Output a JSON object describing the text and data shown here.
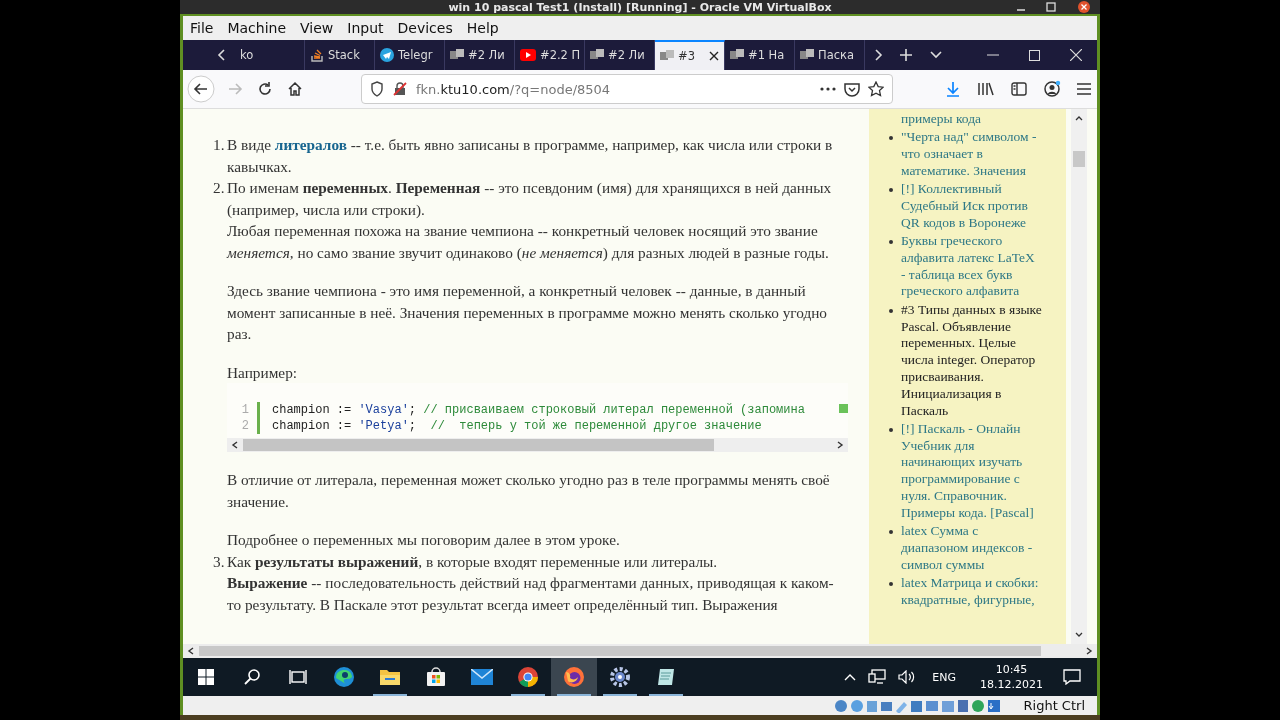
{
  "window": {
    "title": "win 10 pascal Test1 (Install) [Running] - Oracle VM VirtualBox"
  },
  "menu": [
    "File",
    "Machine",
    "View",
    "Input",
    "Devices",
    "Help"
  ],
  "tabs": [
    {
      "label": "ko",
      "kind": "none",
      "selected": false
    },
    {
      "label": "Stack",
      "kind": "stack",
      "selected": false
    },
    {
      "label": "Telegr",
      "kind": "telegram",
      "selected": false
    },
    {
      "label": "#2 Ли",
      "kind": "page",
      "selected": false
    },
    {
      "label": "#2.2 П",
      "kind": "video",
      "selected": false
    },
    {
      "label": "#2 Ли",
      "kind": "page",
      "selected": false
    },
    {
      "label": "#3",
      "kind": "page",
      "selected": true
    },
    {
      "label": "#1 На",
      "kind": "page",
      "selected": false
    },
    {
      "label": "Паска",
      "kind": "page",
      "selected": false
    }
  ],
  "address": {
    "prefix": "fkn.",
    "domain": "ktu10.com",
    "suffix": "/?q=node/8504"
  },
  "article": [
    {
      "marker": "1.",
      "blocks": [
        {
          "kind": "para",
          "spaced": false,
          "parts": [
            {
              "kind": "text",
              "text": "В виде "
            },
            {
              "kind": "link",
              "text": "литералов"
            },
            {
              "kind": "text",
              "text": " -- т.е. быть явно записаны в программе, например, как числа или строки в кавычках."
            }
          ]
        }
      ]
    },
    {
      "marker": "2.",
      "blocks": [
        {
          "kind": "para",
          "spaced": false,
          "parts": [
            {
              "kind": "text",
              "text": "По именам **переменных**. **Переменная** -- это псевдоним (имя) для хранящихся в ней данных (например, числа или строки)."
            }
          ]
        },
        {
          "kind": "para",
          "spaced": false,
          "parts": [
            {
              "kind": "text",
              "text": "Любая переменная похожа на звание чемпиона -- конкретный человек носящий это звание *меняется*, но само звание звучит одинаково (*не меняется*) для разных людей в разные годы."
            }
          ]
        },
        {
          "kind": "para",
          "spaced": true,
          "parts": [
            {
              "kind": "text",
              "text": "Здесь звание чемпиона - это имя переменной, а конкретный человек -- данные, в данный момент записанные в неё. Значения переменных в программе можно менять сколько угодно раз."
            }
          ]
        },
        {
          "kind": "para",
          "spaced": true,
          "parts": [
            {
              "kind": "text",
              "text": "Например:"
            }
          ]
        },
        {
          "kind": "code",
          "spaced": true,
          "lines": [
            {
              "number": "1",
              "tokens": [
                {
                  "kind": "ident",
                  "text": "champion"
                },
                {
                  "kind": "op",
                  "text": " := "
                },
                {
                  "kind": "string",
                  "text": "'Vasya'"
                },
                {
                  "kind": "op",
                  "text": "; "
                },
                {
                  "kind": "comment",
                  "text": "// присваиваем строковый литерал переменной (запомина"
                }
              ]
            },
            {
              "number": "2",
              "tokens": [
                {
                  "kind": "ident",
                  "text": "champion"
                },
                {
                  "kind": "op",
                  "text": " := "
                },
                {
                  "kind": "string",
                  "text": "'Petya'"
                },
                {
                  "kind": "op",
                  "text": ";  "
                },
                {
                  "kind": "comment",
                  "text": "//  теперь у той же переменной другое значение"
                }
              ]
            }
          ]
        },
        {
          "kind": "para",
          "spaced": true,
          "parts": [
            {
              "kind": "text",
              "text": "В отличие от литерала, переменная может сколько угодно раз в теле программы менять своё значение."
            }
          ]
        },
        {
          "kind": "para",
          "spaced": true,
          "parts": [
            {
              "kind": "text",
              "text": "Подробнее о переменных мы поговорим далее в этом уроке."
            }
          ]
        }
      ]
    },
    {
      "marker": "3.",
      "blocks": [
        {
          "kind": "para",
          "spaced": false,
          "parts": [
            {
              "kind": "text",
              "text": "Как **результаты выражений**, в которые входят переменные или литералы."
            }
          ]
        },
        {
          "kind": "para",
          "spaced": false,
          "parts": [
            {
              "kind": "text",
              "text": "**Выражение** -- последовательность действий над фрагментами данных, приводящая к каком-то результату. В Паскале этот результат всегда имеет определённый тип. Выражения"
            }
          ]
        }
      ]
    }
  ],
  "sidebar": [
    {
      "kind": "continuation",
      "text": "примеры кода",
      "selected": false
    },
    {
      "kind": "item",
      "text": "\"Черта над\" символом - что означает в математике. Значения",
      "selected": false
    },
    {
      "kind": "item",
      "text": "[!] Коллективный Судебный Иск против QR кодов в Воронеже",
      "selected": false
    },
    {
      "kind": "item",
      "text": "Буквы греческого алфавита латекс LaTeX - таблица всех букв греческого алфавита",
      "selected": false
    },
    {
      "kind": "item",
      "text": "#3 Типы данных в языке Pascal. Объявление переменных. Целые числа integer. Оператор присваивания. Инициализация в Паскаль",
      "selected": true
    },
    {
      "kind": "item",
      "text": "[!] Паскаль - Онлайн Учебник для начинающих изучать программирование с нуля. Справочник. Примеры кода. [Pascal]",
      "selected": false
    },
    {
      "kind": "item",
      "text": "latex Сумма с диапазоном индексов - символ суммы",
      "selected": false
    },
    {
      "kind": "item",
      "text": "latex Матрица и скобки: квадратные, фигурные,",
      "selected": false
    }
  ],
  "taskbar": {
    "apps": [
      {
        "kind": "start",
        "active": false,
        "running": false
      },
      {
        "kind": "search",
        "active": false,
        "running": false
      },
      {
        "kind": "taskview",
        "active": false,
        "running": false
      },
      {
        "kind": "edge",
        "active": false,
        "running": false
      },
      {
        "kind": "folder",
        "active": false,
        "running": true
      },
      {
        "kind": "store",
        "active": false,
        "running": false
      },
      {
        "kind": "mail",
        "active": false,
        "running": false
      },
      {
        "kind": "chrome",
        "active": false,
        "running": true
      },
      {
        "kind": "firefox",
        "active": true,
        "running": true
      },
      {
        "kind": "gear",
        "active": false,
        "running": true
      },
      {
        "kind": "notepad",
        "active": false,
        "running": true
      }
    ],
    "language": "ENG",
    "time": "10:45",
    "date": "18.12.2021"
  },
  "status_bar": {
    "host_key": "Right Ctrl"
  }
}
